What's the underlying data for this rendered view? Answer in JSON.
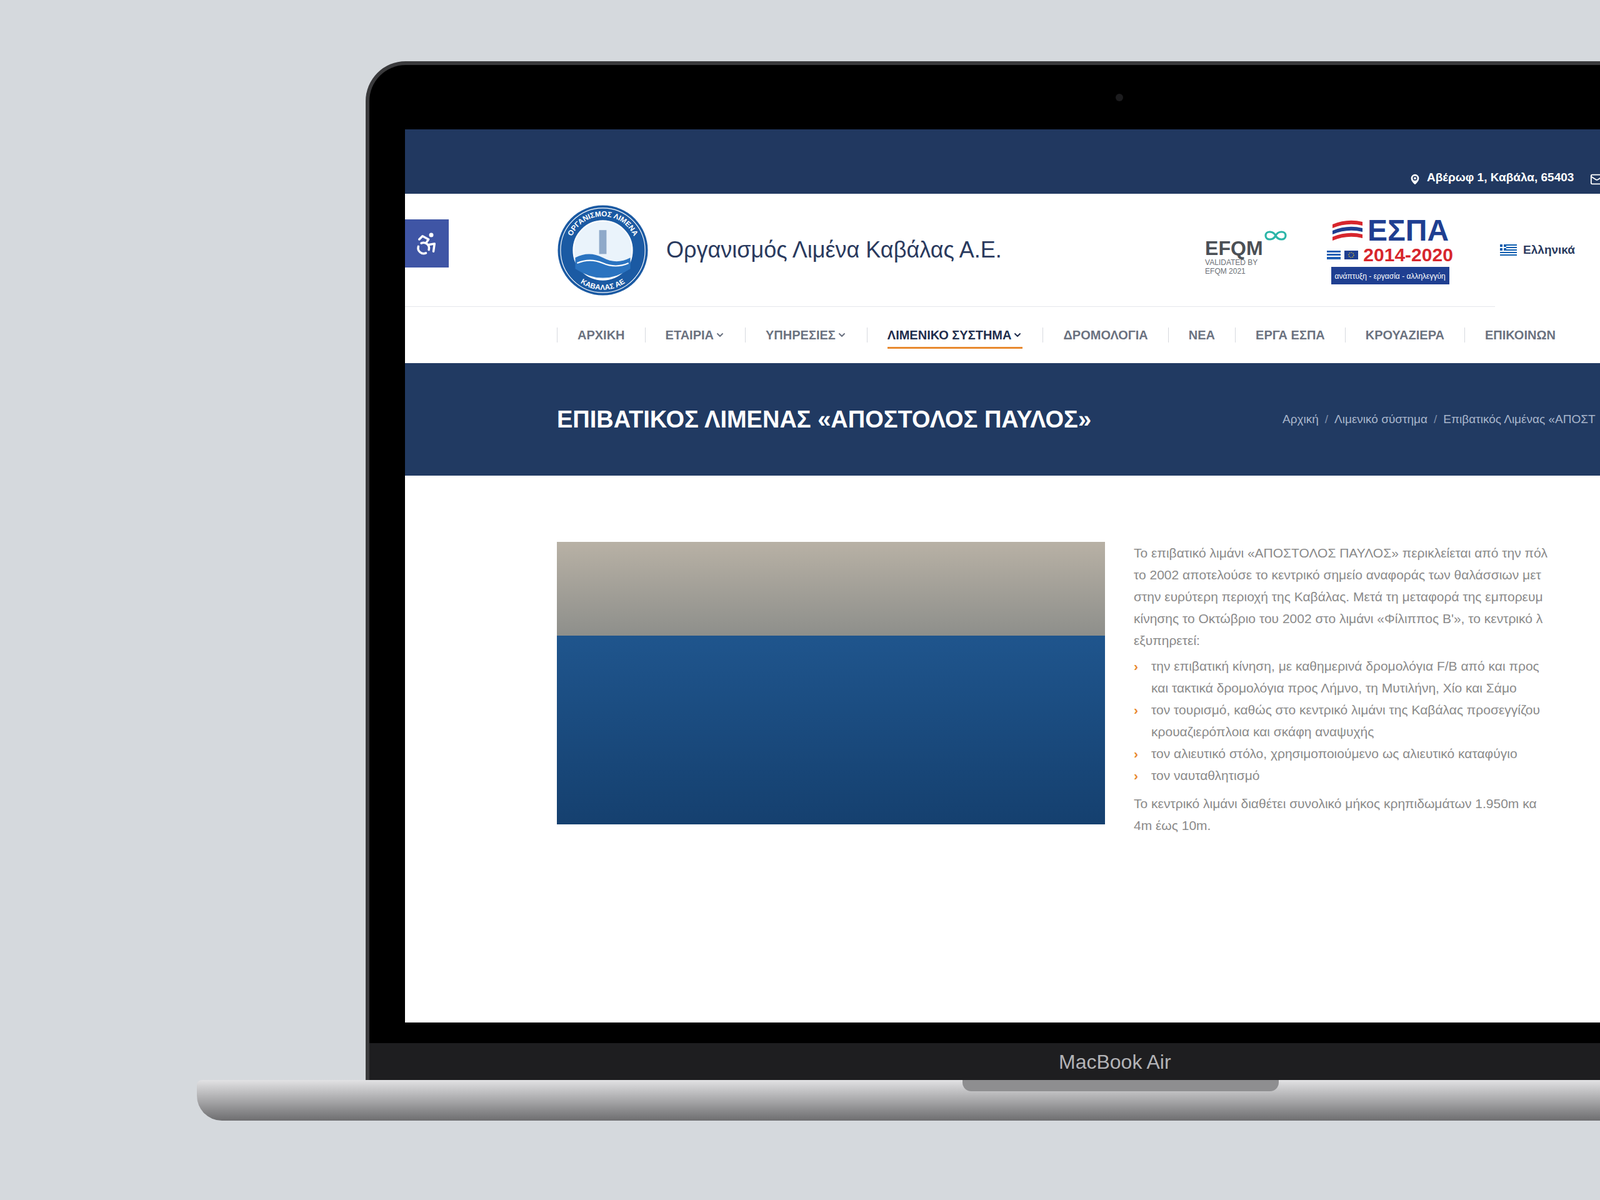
{
  "device": {
    "label": "MacBook Air"
  },
  "topbar": {
    "address": "Αβέρωφ 1, Καβάλα, 65403",
    "email": "in"
  },
  "header": {
    "logo_ring_top": "ΟΡΓΑΝΙΣΜΟΣ ΛΙΜΕΝΑ",
    "logo_ring_bottom": "ΚΑΒΑΛΑΣ ΑΕ",
    "title": "Οργανισμός Λιμένα Καβάλας Α.Ε.",
    "efqm": {
      "name": "EFQM",
      "line1": "VALIDATED BY",
      "line2": "EFQM 2021"
    },
    "espa": {
      "name": "ΕΣΠΑ",
      "years": "2014-2020",
      "motto": "ανάπτυξη - εργασία - αλληλεγγύη"
    },
    "language": "Ελληνικά"
  },
  "nav": [
    {
      "label": "ΑΡΧΙΚΗ",
      "dropdown": false,
      "selected": false
    },
    {
      "label": "ΕΤΑΙΡΙΑ",
      "dropdown": true,
      "selected": false
    },
    {
      "label": "ΥΠΗΡΕΣΙΕΣ",
      "dropdown": true,
      "selected": false
    },
    {
      "label": "ΛΙΜΕΝΙΚΟ ΣΥΣΤΗΜΑ",
      "dropdown": true,
      "selected": true
    },
    {
      "label": "ΔΡΟΜΟΛΟΓΙΑ",
      "dropdown": false,
      "selected": false
    },
    {
      "label": "ΝΕΑ",
      "dropdown": false,
      "selected": false
    },
    {
      "label": "ΕΡΓΑ ΕΣΠΑ",
      "dropdown": false,
      "selected": false
    },
    {
      "label": "ΚΡΟΥΑΖΙΕΡΑ",
      "dropdown": false,
      "selected": false
    },
    {
      "label": "ΕΠΙΚΟΙΝΩΝ",
      "dropdown": false,
      "selected": false
    }
  ],
  "page": {
    "title": "ΕΠΙΒΑΤΙΚΟΣ ΛΙΜΕΝΑΣ «ΑΠΟΣΤΟΛΟΣ ΠΑΥΛΟΣ»",
    "breadcrumbs": [
      "Αρχική",
      "Λιμενικό σύστημα",
      "Επιβατικός Λιμένας «ΑΠΟΣΤ"
    ],
    "separator": "/"
  },
  "content": {
    "intro_lines": [
      "Το επιβατικό λιμάνι «ΑΠΟΣΤΟΛΟΣ ΠΑΥΛΟΣ» περικλείεται από την πόλ",
      "το 2002 αποτελούσε το κεντρικό σημείο αναφοράς των θαλάσσιων μετ",
      "στην ευρύτερη περιοχή της Καβάλας. Μετά τη μεταφορά της εμπορευμ",
      "κίνησης το Οκτώβριο του 2002 στο λιμάνι «Φίλιππος Β'», το κεντρικό λ",
      "εξυπηρετεί:"
    ],
    "bullet_marker": "›",
    "bullets": [
      {
        "lines": [
          "την επιβατική κίνηση, με καθημερινά δρομολόγια F/B από και προς",
          "και τακτικά δρομολόγια προς Λήμνο, τη Μυτιλήνη, Χίο και Σάμο"
        ]
      },
      {
        "lines": [
          "τον τουρισμό, καθώς στο κεντρικό λιμάνι της Καβάλας προσεγγίζου",
          "κρουαζιερόπλοια και σκάφη αναψυχής"
        ]
      },
      {
        "lines": [
          "τον αλιευτικό στόλο, χρησιμοποιούμενο ως αλιευτικό καταφύγιο"
        ]
      },
      {
        "lines": [
          "τον ναυταθλητισμό"
        ]
      }
    ],
    "outro_lines": [
      "Το κεντρικό λιμάνι διαθέτει συνολικό μήκος κρηπιδωμάτων 1.950m κα",
      "4m έως 10m."
    ]
  }
}
